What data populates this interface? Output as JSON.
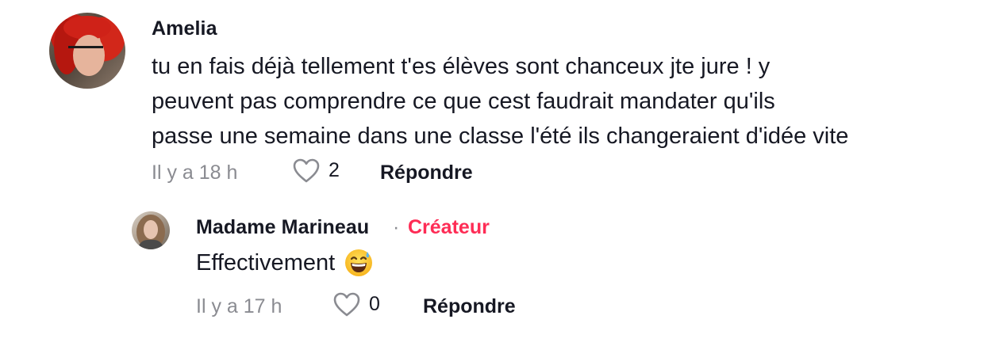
{
  "comment": {
    "username": "Amelia",
    "text_lines": [
      "tu en fais déjà tellement t'es élèves sont chanceux jte jure ! y",
      "peuvent pas comprendre ce que cest faudrait mandater qu'ils",
      "passe une semaine dans une classe l'été ils changeraient d'idée vite"
    ],
    "time": "Il y a 18 h",
    "likes": "2",
    "reply_label": "Répondre"
  },
  "reply": {
    "username": "Madame Marineau",
    "separator": "·",
    "badge": "Créateur",
    "text": "Effectivement",
    "emoji_icon": "grinning-face-with-sweat-icon",
    "time": "Il y a 17 h",
    "likes": "0",
    "reply_label": "Répondre"
  },
  "colors": {
    "text_primary": "#161823",
    "text_secondary": "#8a8b91",
    "creator_accent": "#fe2c55"
  }
}
